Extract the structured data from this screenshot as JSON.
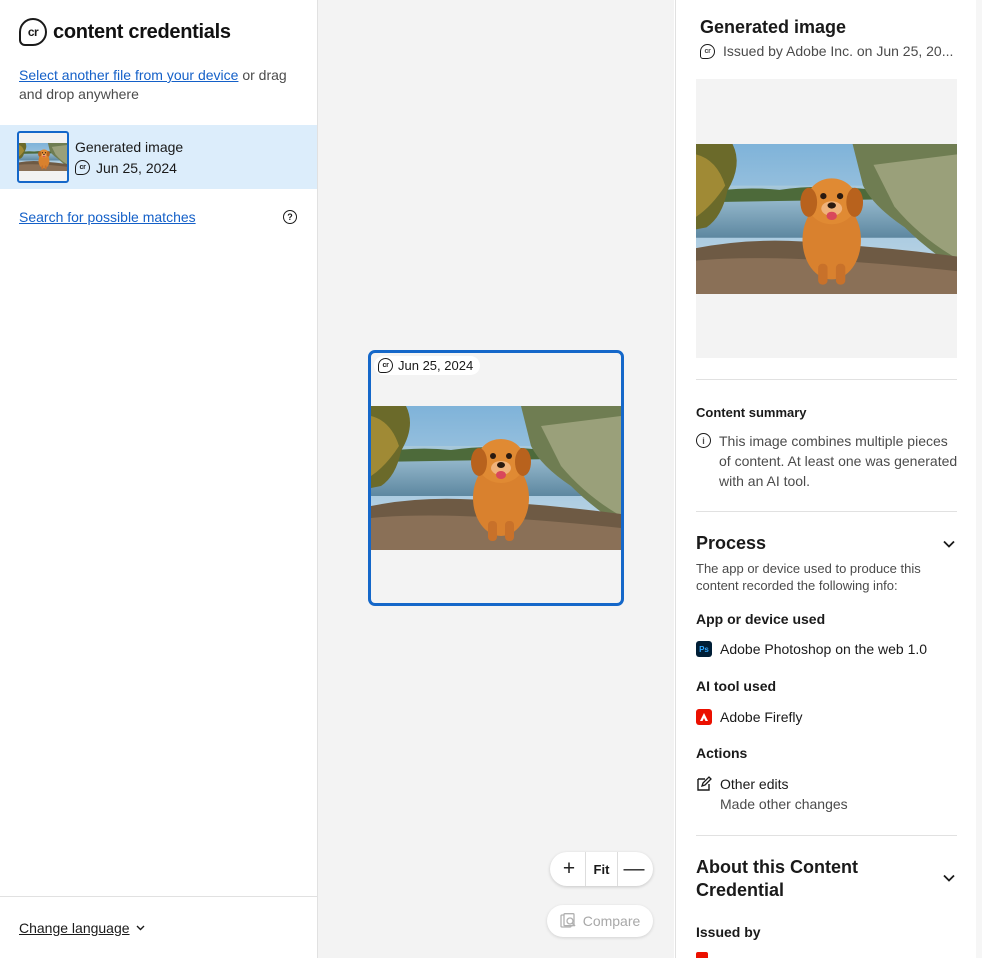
{
  "app": {
    "logo_badge": "cr",
    "name": "content credentials"
  },
  "upload": {
    "link_text": "Select another file from your device",
    "rest_text": " or drag and drop anywhere"
  },
  "file": {
    "title": "Generated image",
    "date": "Jun 25, 2024"
  },
  "search": {
    "label": "Search for possible matches",
    "help": "?"
  },
  "footer": {
    "language_label": "Change language",
    "chevron": "⌄"
  },
  "canvas": {
    "card_date": "Jun 25, 2024",
    "zoom_in": "+",
    "zoom_fit": "Fit",
    "zoom_out": "—",
    "compare_label": "Compare"
  },
  "panel": {
    "title": "Generated image",
    "issued": "Issued by Adobe Inc. on Jun 25, 20...",
    "content_summary": {
      "heading": "Content summary",
      "text": "This image combines multiple pieces of content. At least one was generated with an AI tool."
    },
    "process": {
      "heading": "Process",
      "description": "The app or device used to produce this content recorded the following info:",
      "app_heading": "App or device used",
      "app_name": "Adobe Photoshop on the web 1.0",
      "app_icon_label": "Ps",
      "ai_heading": "AI tool used",
      "ai_name": "Adobe Firefly",
      "actions_heading": "Actions",
      "action_name": "Other edits",
      "action_desc": "Made other changes"
    },
    "about": {
      "heading": "About this Content Credential",
      "issued_by_heading": "Issued by"
    }
  },
  "colors": {
    "accent": "#1467c9",
    "link": "#1460c8",
    "selected_bg": "#dcedfb",
    "canvas_bg": "#f3f3f3"
  }
}
